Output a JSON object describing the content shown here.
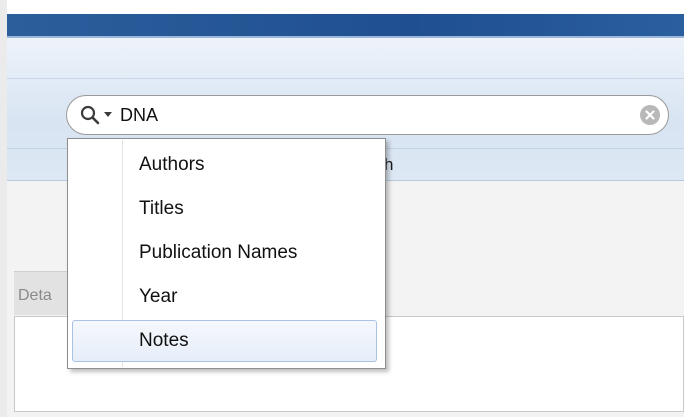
{
  "toolbar": {
    "label_fragment": "h"
  },
  "search": {
    "value": "DNA",
    "icon": "search-icon",
    "dropdown_icon": "chevron-down-icon",
    "clear_icon": "clear-icon"
  },
  "menu": {
    "items": [
      {
        "label": "Authors"
      },
      {
        "label": "Titles"
      },
      {
        "label": "Publication Names"
      },
      {
        "label": "Year"
      },
      {
        "label": "Notes"
      }
    ],
    "highlighted": "Notes"
  },
  "panel": {
    "tab_label": "Deta"
  },
  "colors": {
    "title_bar": "#1f4f8f",
    "ribbon": "#dde8f4",
    "menu_highlight_border": "#a9c2e3",
    "menu_highlight_fill": "#e6eef9"
  }
}
